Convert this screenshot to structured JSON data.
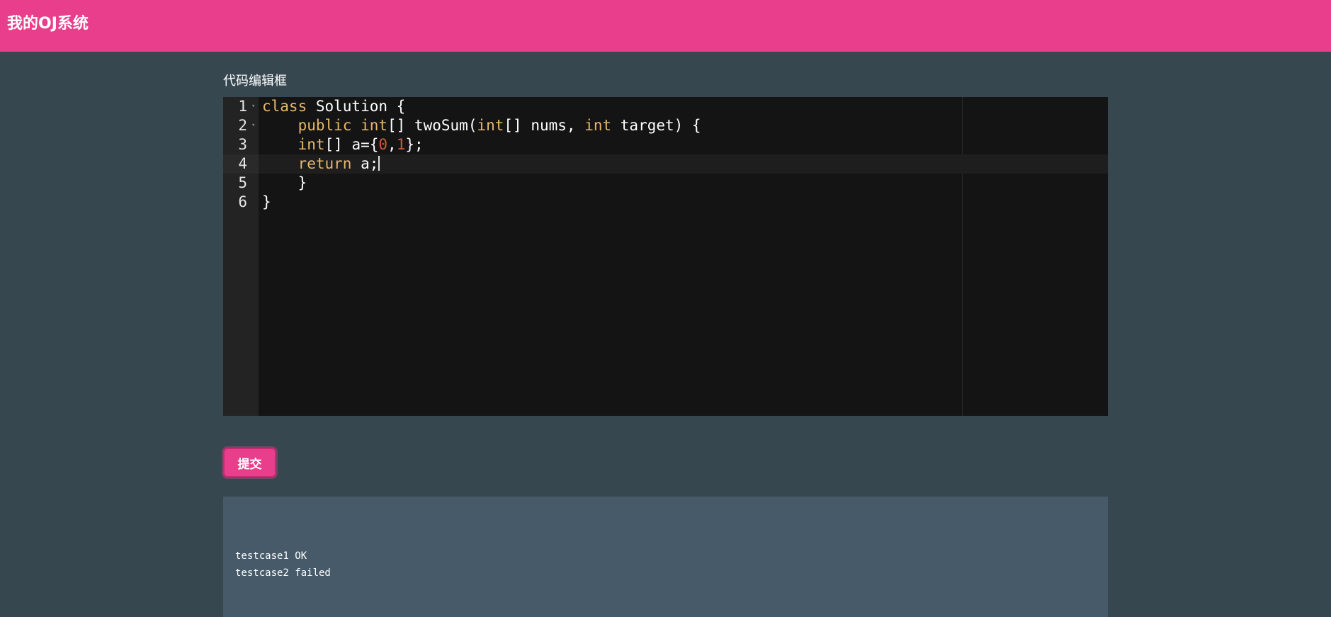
{
  "header": {
    "title": "我的OJ系统"
  },
  "editor": {
    "label": "代码编辑框",
    "line_numbers": [
      "1",
      "2",
      "3",
      "4",
      "5",
      "6"
    ],
    "active_line": 4,
    "lines": [
      [
        {
          "t": "class",
          "k": "kw"
        },
        {
          "t": " Solution {",
          "k": "plain"
        }
      ],
      [
        {
          "t": "    ",
          "k": "plain"
        },
        {
          "t": "public",
          "k": "kw"
        },
        {
          "t": " ",
          "k": "plain"
        },
        {
          "t": "int",
          "k": "kw"
        },
        {
          "t": "[] twoSum(",
          "k": "plain"
        },
        {
          "t": "int",
          "k": "kw"
        },
        {
          "t": "[] nums, ",
          "k": "plain"
        },
        {
          "t": "int",
          "k": "kw"
        },
        {
          "t": " target) {",
          "k": "plain"
        }
      ],
      [
        {
          "t": "    ",
          "k": "plain"
        },
        {
          "t": "int",
          "k": "kw"
        },
        {
          "t": "[] a={",
          "k": "plain"
        },
        {
          "t": "0",
          "k": "num"
        },
        {
          "t": ",",
          "k": "plain"
        },
        {
          "t": "1",
          "k": "num"
        },
        {
          "t": "};",
          "k": "plain"
        }
      ],
      [
        {
          "t": "    ",
          "k": "plain"
        },
        {
          "t": "return",
          "k": "kw"
        },
        {
          "t": " a;",
          "k": "plain"
        }
      ],
      [
        {
          "t": "    }",
          "k": "plain"
        }
      ],
      [
        {
          "t": "}",
          "k": "plain"
        }
      ]
    ],
    "colors": {
      "keyword": "#e6b86a",
      "number": "#cc5a3a",
      "text": "#ffffff",
      "background": "#141414"
    }
  },
  "submit": {
    "label": "提交"
  },
  "results": {
    "lines": [
      "testcase1 OK",
      "testcase2 failed"
    ]
  },
  "theme": {
    "accent": "#e83e8c",
    "page_bg": "#37474f",
    "panel_bg": "#465a69"
  }
}
